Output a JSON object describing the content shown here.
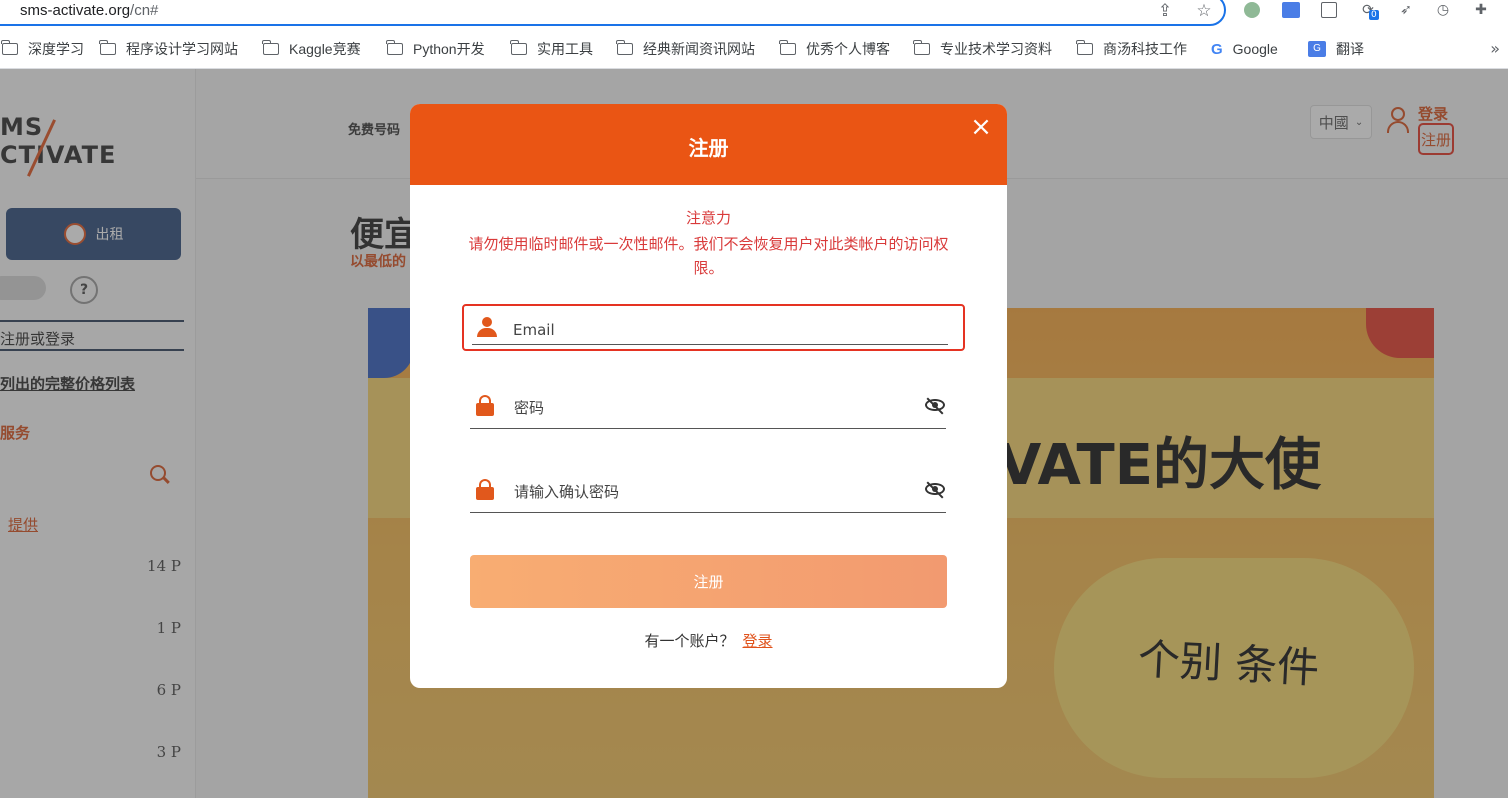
{
  "browser": {
    "url_host": "sms-activate.org",
    "url_path": "/cn#",
    "bookmarks": [
      {
        "label": "深度学习",
        "type": "folder"
      },
      {
        "label": "程序设计学习网站",
        "type": "folder"
      },
      {
        "label": "Kaggle竞赛",
        "type": "folder"
      },
      {
        "label": "Python开发",
        "type": "folder"
      },
      {
        "label": "实用工具",
        "type": "folder"
      },
      {
        "label": "经典新闻资讯网站",
        "type": "folder"
      },
      {
        "label": "优秀个人博客",
        "type": "folder"
      },
      {
        "label": "专业技术学习资料",
        "type": "folder"
      },
      {
        "label": "商汤科技工作",
        "type": "folder"
      },
      {
        "label": "Google",
        "type": "google"
      },
      {
        "label": "翻译",
        "type": "translate"
      }
    ],
    "more_glyph": "»",
    "ext_badge": "0"
  },
  "sidebar": {
    "logo_line1": "MS",
    "logo_line2": "CTIVATE",
    "rent_button": "出租",
    "help": "?",
    "register_or_login": "注册或登录",
    "price_list_link": "列出的完整价格列表",
    "services_label": "服务",
    "provide_link": "提供",
    "prices": [
      "14 P",
      "1 P",
      "6 P",
      "3 P"
    ]
  },
  "topnav": {
    "free_numbers": "免费号码",
    "language": "中國",
    "login": "登录",
    "register": "注册"
  },
  "main": {
    "headline": "便宜",
    "subline": "以最低的",
    "banner_title": "VATE的大使",
    "banner_sub": "个别 条件"
  },
  "modal": {
    "title": "注册",
    "close": "×",
    "warning_title": "注意力",
    "warning_body": "请勿使用临时邮件或一次性邮件。我们不会恢复用户对此类帐户的访问权限。",
    "email_placeholder": "Email",
    "password_placeholder": "密码",
    "confirm_placeholder": "请输入确认密码",
    "submit": "注册",
    "have_account": "有一个账户？",
    "login_link": "登录"
  },
  "colors": {
    "brand_orange": "#ea5514",
    "warning_red": "#d93a3a",
    "highlight_red": "#e53322",
    "button_gradient_start": "#f8ad72",
    "button_gradient_end": "#f29a70"
  }
}
